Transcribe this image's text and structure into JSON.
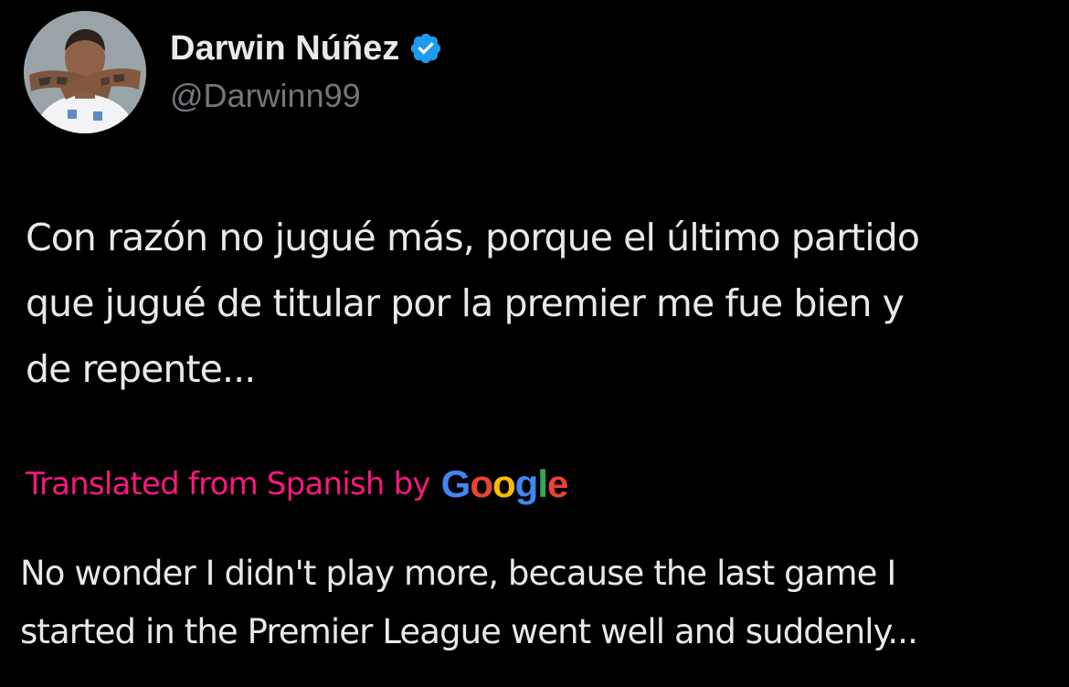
{
  "author": {
    "display_name": "Darwin Núñez",
    "handle": "@Darwinn99",
    "avatar_icon": "profile-photo",
    "verified_icon": "verified-badge-icon",
    "verified_color": "#1d9bf0"
  },
  "tweet": {
    "text": "Con razón no jugué más, porque el último partido\nque jugué de titular por la premier me fue bien y\nde repente..."
  },
  "translation": {
    "label": "Translated from Spanish by",
    "provider": "Google",
    "label_color": "#f91880",
    "google_colors": [
      "#4285f4",
      "#ea4335",
      "#fbbc05",
      "#4285f4",
      "#34a853",
      "#ea4335"
    ],
    "text": "No wonder I didn't play more, because the last game I\nstarted in the Premier League went well and suddenly..."
  },
  "colors": {
    "background": "#000000",
    "primary_text": "#e7e9ea",
    "secondary_text": "#71767b"
  }
}
